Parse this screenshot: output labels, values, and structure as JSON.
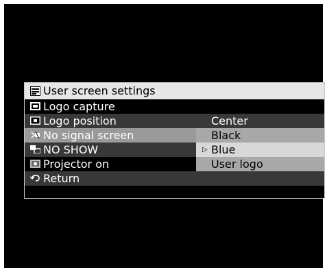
{
  "menu": {
    "title": "User screen settings",
    "title_icon": "menu-icon",
    "items": [
      {
        "label": "Logo capture",
        "icon": "logo-capture-icon"
      },
      {
        "label": "Logo position",
        "icon": "logo-position-icon"
      },
      {
        "label": "No signal screen",
        "icon": "no-signal-icon"
      },
      {
        "label": "NO SHOW",
        "icon": "no-show-icon"
      },
      {
        "label": "Projector on",
        "icon": "projector-on-icon"
      },
      {
        "label": "Return",
        "icon": "return-icon"
      }
    ],
    "logo_position_value": "Center",
    "no_signal_options": [
      "Black",
      "Blue",
      "User logo"
    ],
    "selected_option": "Blue"
  },
  "colors": {
    "background": "#000000",
    "title_bar": "#e6e6e6",
    "row_dark": "#383838",
    "row_highlight": "#9a9a9a",
    "option_panel": "#a8a8a8",
    "option_selected": "#d8d8d8"
  }
}
